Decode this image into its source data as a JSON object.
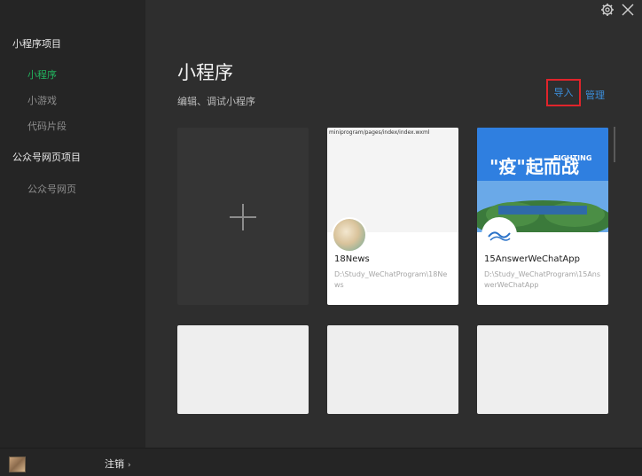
{
  "sidebar": {
    "groups": [
      {
        "label": "小程序项目"
      },
      {
        "label": "公众号网页项目"
      }
    ],
    "items": [
      {
        "label": "小程序",
        "active": true
      },
      {
        "label": "小游戏"
      },
      {
        "label": "代码片段"
      },
      {
        "label": "公众号网页"
      }
    ]
  },
  "main": {
    "title": "小程序",
    "subtitle": "编辑、调试小程序",
    "import_label": "导入",
    "manage_label": "管理"
  },
  "projects": [
    {
      "thumb_path": "miniprogram/pages/index/index.wxml",
      "name": "18News",
      "path": "D:\\Study_WeChatProgram\\18News"
    },
    {
      "banner_text": "\"疫\"起而战",
      "banner_sub": "FIGHTING",
      "name": "15AnswerWeChatApp",
      "path": "D:\\Study_WeChatProgram\\15AnswerWeChatApp"
    }
  ],
  "footer": {
    "logout_label": "注销",
    "logout_chevron": "›"
  },
  "colors": {
    "accent_green": "#22b35e",
    "link_blue": "#3b8fdc",
    "highlight_red": "#e0242b"
  },
  "icons": [
    "gear-icon",
    "close-icon",
    "plus-icon",
    "chevron-right-icon"
  ]
}
